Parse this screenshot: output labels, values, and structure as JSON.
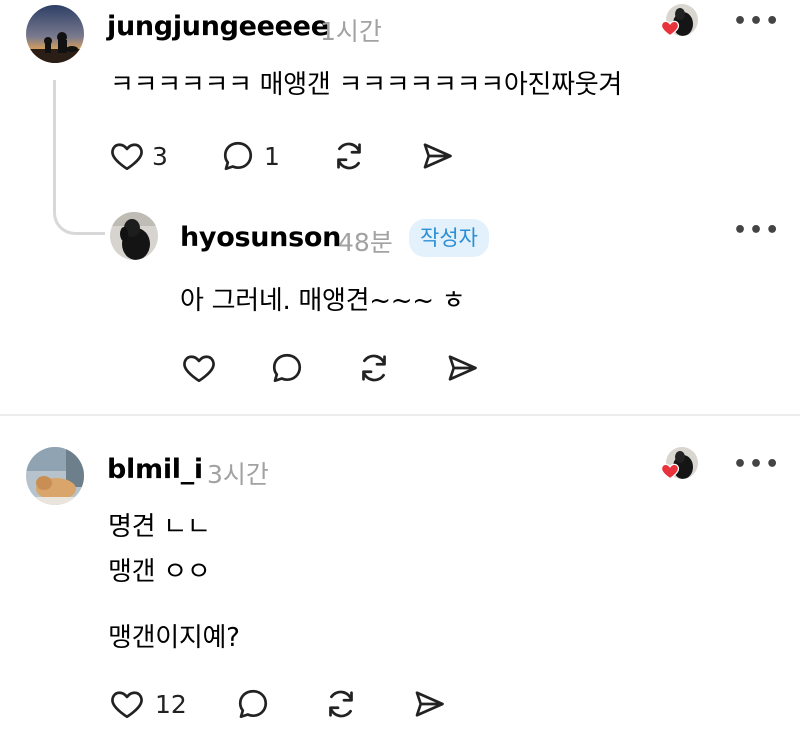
{
  "comments": [
    {
      "username": "jungjungeeeee",
      "time": "1시간",
      "text": "ㅋㅋㅋㅋㅋㅋ 매앵갠 ㅋㅋㅋㅋㅋㅋㅋ아진짜웃겨",
      "likes": "3",
      "replies": "1",
      "liked_by_author": true
    },
    {
      "username": "hyosunson",
      "time": "48분",
      "badge": "작성자",
      "text": "아 그러네.  매앵견~~~ ㅎ",
      "likes": "",
      "replies": ""
    },
    {
      "username": "blmil_i",
      "time": "3시간",
      "lines": [
        "명견 ㄴㄴ",
        "맹갠 ㅇㅇ",
        "맹갠이지예?"
      ],
      "likes": "12",
      "replies": "",
      "liked_by_author": true
    }
  ],
  "colors": {
    "heart_red": "#e8323c",
    "badge_bg": "#e3f1fc",
    "badge_text": "#2b8fd6",
    "muted": "#a2a2a2"
  },
  "icons": [
    "heart-icon",
    "comment-icon",
    "repost-icon",
    "share-icon",
    "more-icon"
  ]
}
